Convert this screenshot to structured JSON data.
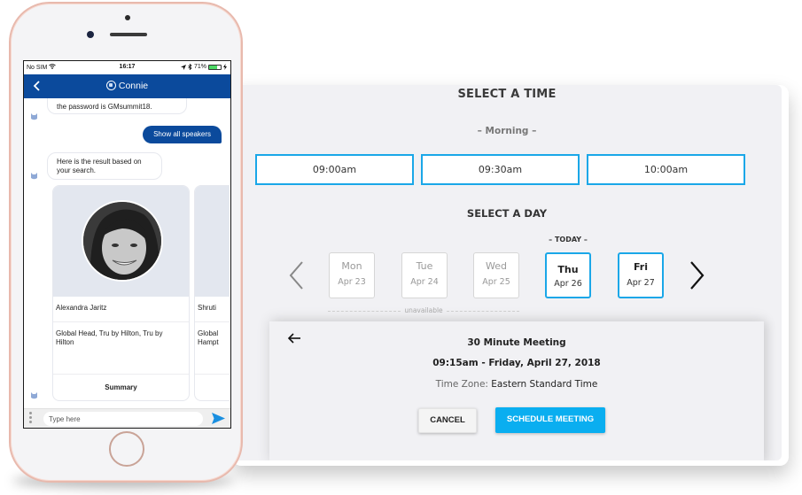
{
  "colors": {
    "brand_blue": "#0b4a9c",
    "accent_cyan": "#1aa7e8",
    "schedule_button": "#0aaef0",
    "panel_bg": "#f1f1f4",
    "phone_rose": "#e8b9ad"
  },
  "phone": {
    "status_bar": {
      "carrier": "No SIM",
      "time": "16:17",
      "battery": "71%",
      "battery_level": 0.71
    },
    "nav": {
      "back_icon": "chevron-left-icon",
      "title": "Connie",
      "avatar_icon": "bot-avatar-icon"
    },
    "messages": [
      {
        "from": "bot",
        "text": "the password is GMsummit18."
      },
      {
        "from": "user",
        "text": "Show all speakers"
      },
      {
        "from": "bot",
        "text": "Here is the result based on your search."
      }
    ],
    "speaker_cards": [
      {
        "name": "Alexandra Jaritz",
        "role": "Global Head, Tru by Hilton, Tru by Hilton",
        "action": "Summary"
      },
      {
        "name": "Shruti",
        "role": "Global Hampt"
      }
    ],
    "composer": {
      "placeholder": "Type here",
      "menu_icon": "more-vertical-icon",
      "send_icon": "send-icon"
    }
  },
  "scheduler": {
    "time_title": "SELECT A TIME",
    "period_label": "– Morning –",
    "time_slots": [
      "09:00am",
      "09:30am",
      "10:00am"
    ],
    "day_title": "SELECT A DAY",
    "today_label": "– TODAY –",
    "days": [
      {
        "name": "Mon",
        "date": "Apr 23",
        "available": false
      },
      {
        "name": "Tue",
        "date": "Apr 24",
        "available": false
      },
      {
        "name": "Wed",
        "date": "Apr 25",
        "available": false
      },
      {
        "name": "Thu",
        "date": "Apr 26",
        "available": true,
        "today": true
      },
      {
        "name": "Fri",
        "date": "Apr 27",
        "available": true
      }
    ],
    "unavailable_label": "unavailable",
    "meeting": {
      "title": "30 Minute Meeting",
      "when": "09:15am - Friday, April 27, 2018",
      "tz_label": "Time Zone:",
      "tz_value": "Eastern Standard Time",
      "cancel_label": "CANCEL",
      "schedule_label": "SCHEDULE MEETING"
    }
  }
}
